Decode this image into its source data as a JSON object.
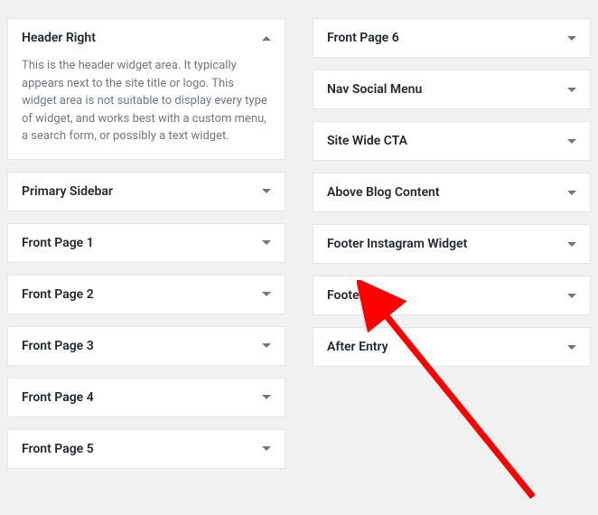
{
  "left_column": [
    {
      "title": "Header Right",
      "expanded": true,
      "description": "This is the header widget area. It typically appears next to the site title or logo. This widget area is not suitable to display every type of widget, and works best with a custom menu, a search form, or possibly a text widget."
    },
    {
      "title": "Primary Sidebar",
      "expanded": false
    },
    {
      "title": "Front Page 1",
      "expanded": false
    },
    {
      "title": "Front Page 2",
      "expanded": false
    },
    {
      "title": "Front Page 3",
      "expanded": false
    },
    {
      "title": "Front Page 4",
      "expanded": false
    },
    {
      "title": "Front Page 5",
      "expanded": false
    }
  ],
  "right_column": [
    {
      "title": "Front Page 6",
      "expanded": false
    },
    {
      "title": "Nav Social Menu",
      "expanded": false
    },
    {
      "title": "Site Wide CTA",
      "expanded": false
    },
    {
      "title": "Above Blog Content",
      "expanded": false
    },
    {
      "title": "Footer Instagram Widget",
      "expanded": false
    },
    {
      "title": "Footer",
      "expanded": false
    },
    {
      "title": "After Entry",
      "expanded": false
    }
  ]
}
